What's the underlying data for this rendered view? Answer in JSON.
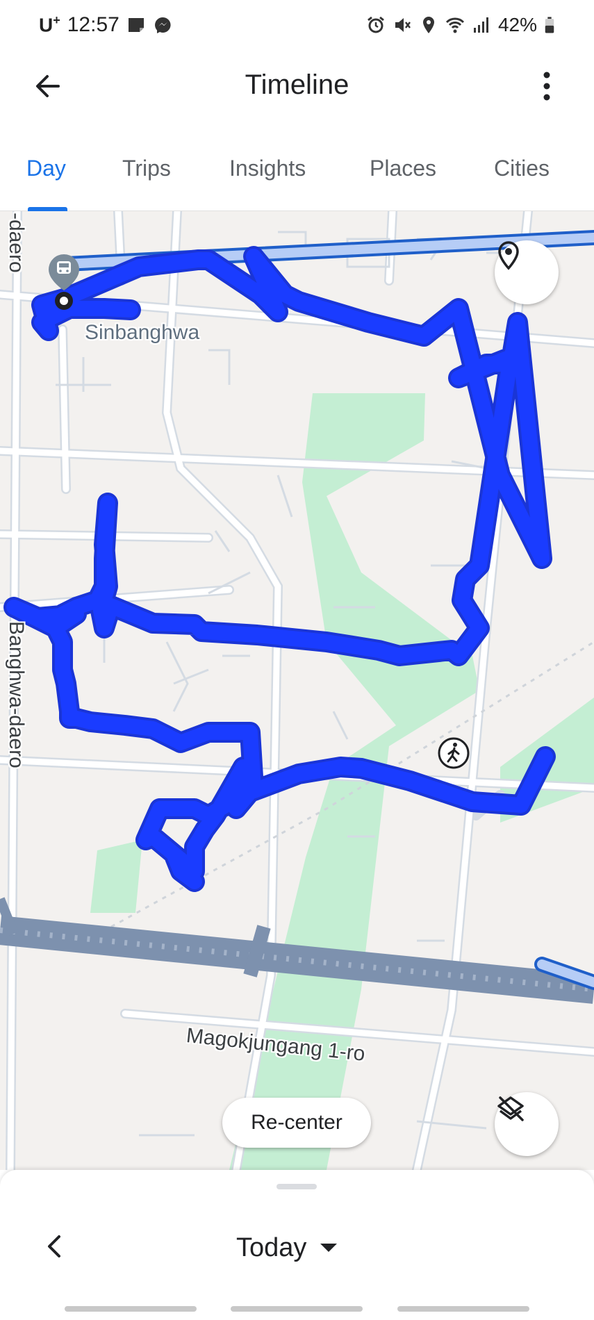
{
  "status_bar": {
    "carrier": "U",
    "carrier_sup": "+",
    "time": "12:57",
    "battery": "42%",
    "left_icons": [
      "notification-icon",
      "messenger-icon"
    ],
    "right_icons": [
      "alarm-icon",
      "mute-icon",
      "location-icon",
      "wifi-icon",
      "signal-icon",
      "battery-icon"
    ]
  },
  "app_bar": {
    "title": "Timeline",
    "back_icon": "arrow-back-icon",
    "more_icon": "more-vert-icon"
  },
  "tabs": [
    {
      "label": "Day",
      "active": true
    },
    {
      "label": "Trips",
      "active": false
    },
    {
      "label": "Insights",
      "active": false
    },
    {
      "label": "Places",
      "active": false
    },
    {
      "label": "Cities",
      "active": false
    }
  ],
  "map": {
    "labels": {
      "street_top": "-daero",
      "street_left": "Banghwa-daero",
      "station": "Sinbanghwa",
      "road_bottom": "Magokjungang 1-ro"
    },
    "icons": [
      "train-icon",
      "walking-icon",
      "location-pin-icon",
      "layers-off-icon"
    ],
    "recenter_label": "Re-center",
    "colors": {
      "route": "#1a3cff",
      "route_outline": "#1a35d6",
      "transit_line": "#1f5fc9",
      "park": "#c4eed3",
      "road": "#ffffff",
      "road_outline": "#d4dbe3",
      "highway": "#8fa2bd"
    }
  },
  "bottom_sheet": {
    "date_label": "Today",
    "prev_icon": "chevron-left-icon",
    "dropdown_icon": "arrow-drop-down-icon"
  }
}
